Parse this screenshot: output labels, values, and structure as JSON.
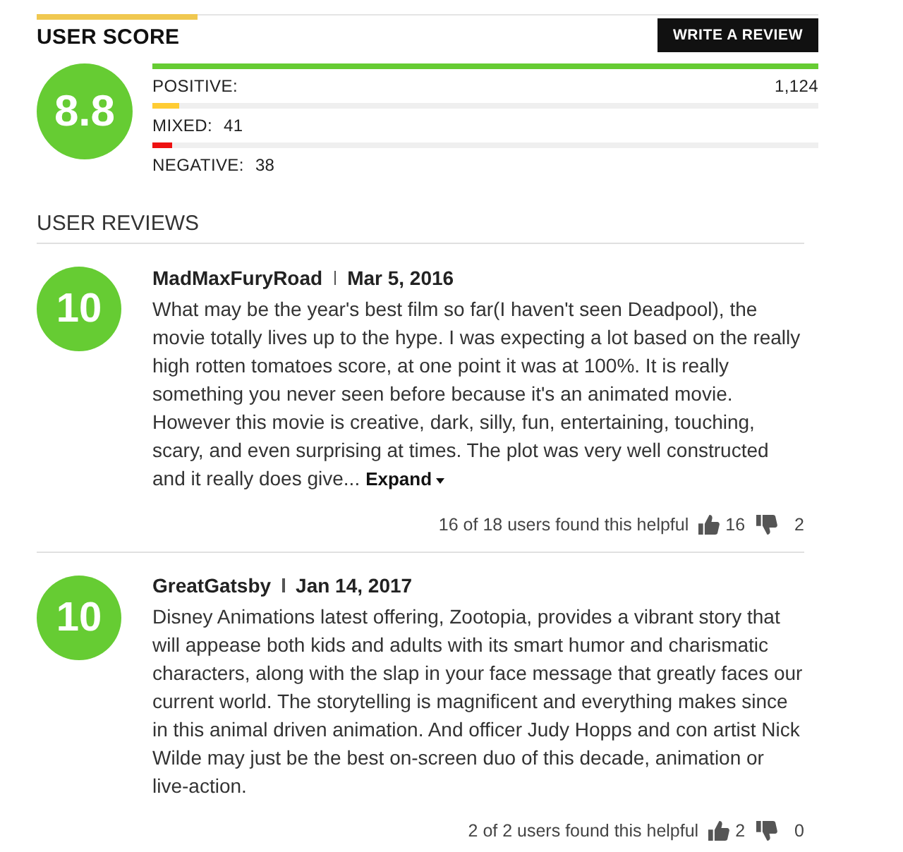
{
  "user_score": {
    "title": "USER SCORE",
    "write_review_button": "WRITE A REVIEW",
    "score": "8.8",
    "breakdown": [
      {
        "label": "POSITIVE:",
        "count": "1,124",
        "level": 1.0,
        "color": "#66cc33"
      },
      {
        "label": "MIXED:",
        "count": "41",
        "level": 0.04,
        "color": "#ffcc33"
      },
      {
        "label": "NEGATIVE:",
        "count": "38",
        "level": 0.03,
        "color": "#ee1111"
      }
    ]
  },
  "user_reviews": {
    "title": "USER REVIEWS",
    "reviews": [
      {
        "score": "10",
        "author": "MadMaxFuryRoad",
        "date": "Mar 5, 2016",
        "body": "What may be the year's best film so far(I haven't seen Deadpool), the movie totally lives up to the hype. I was expecting a lot based on the really high rotten tomatoes score, at one point it was at 100%. It is really something you never seen before because it's an animated movie. However this movie is creative, dark, silly, fun, entertaining, touching, scary, and even surprising at times. The plot was very well constructed and it really does give...",
        "expand": "Expand",
        "helpful": "16 of 18 users found this helpful",
        "up_count": "16",
        "down_count": "2"
      },
      {
        "score": "10",
        "author": "GreatGatsby",
        "date": "Jan 14, 2017",
        "body": "Disney Animations latest offering, Zootopia, provides a vibrant story that will appease both kids and adults with its smart humor and charismatic characters, along with the slap in your face message that greatly faces our current world. The storytelling is magnificent and everything makes since in this animal driven animation. And officer Judy Hopps and con artist Nick Wilde may just be the best on-screen duo of this decade, animation or live-action.",
        "helpful": "2 of 2 users found this helpful",
        "up_count": "2",
        "down_count": "0"
      }
    ]
  }
}
